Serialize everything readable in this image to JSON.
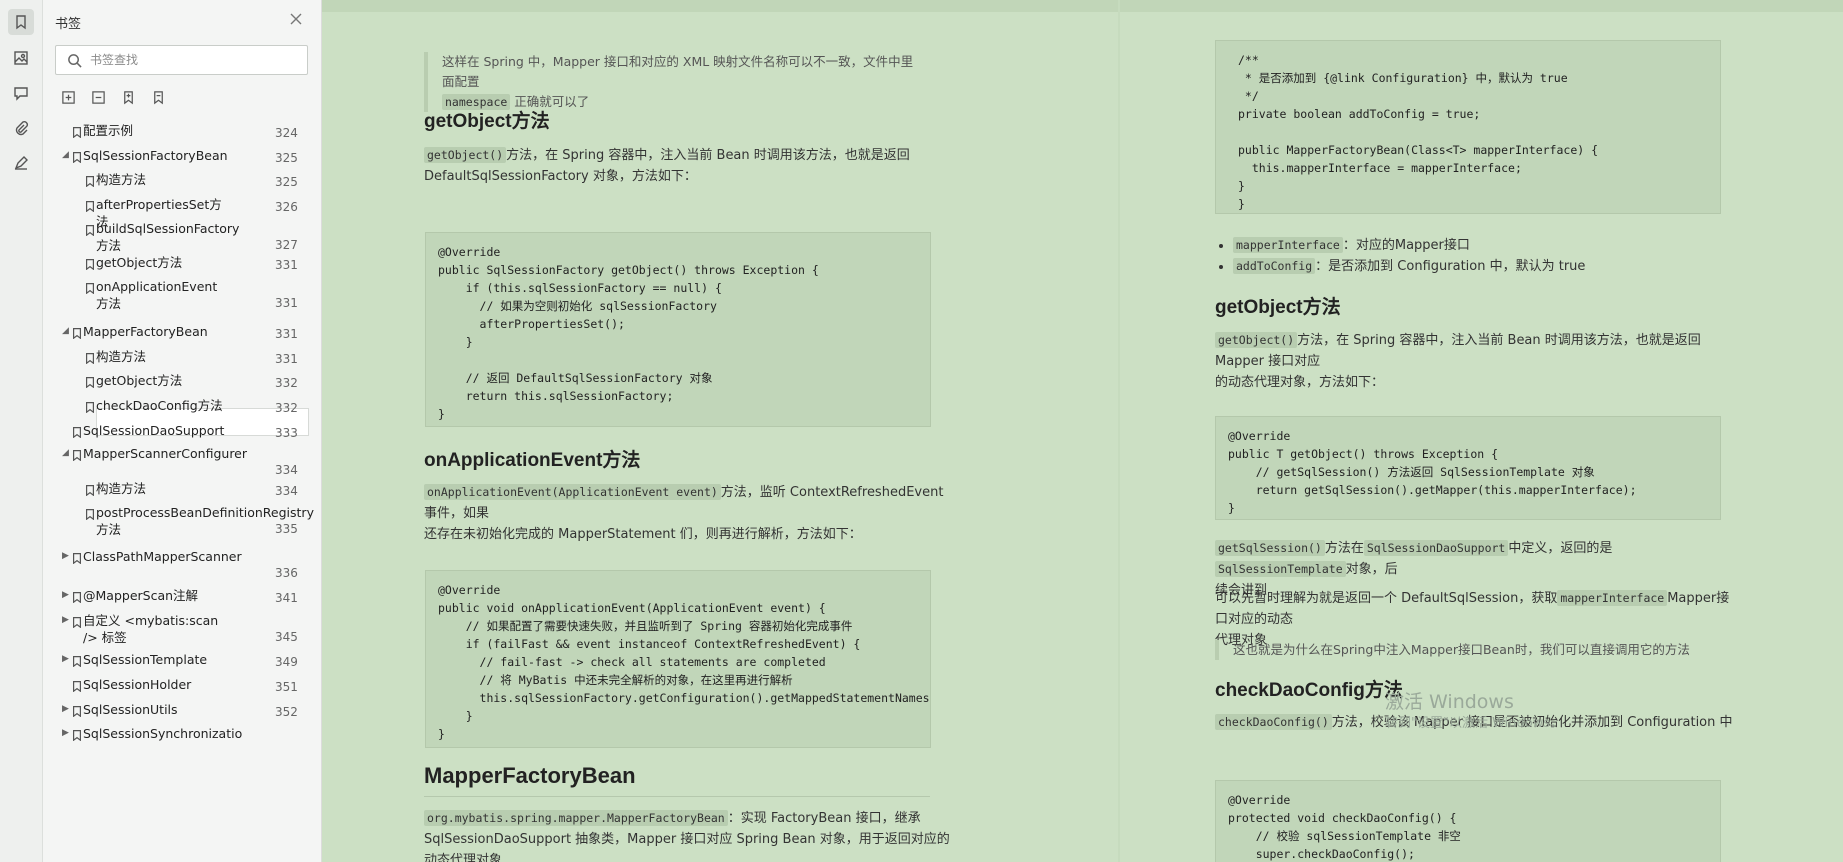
{
  "sidebar": {
    "title": "书签",
    "search_placeholder": "书签查找",
    "items": [
      {
        "label": "配置示例",
        "page": "324",
        "level": 1,
        "toggle": "none"
      },
      {
        "label": "SqlSessionFactoryBean",
        "page": "325",
        "level": 0,
        "toggle": "expanded"
      },
      {
        "label": "构造方法",
        "page": "325",
        "level": 2,
        "toggle": "none"
      },
      {
        "label": "afterPropertiesSet方法",
        "page": "326",
        "level": 2,
        "toggle": "none"
      },
      {
        "label": "buildSqlSessionFactory方法",
        "page": "327",
        "level": 2,
        "toggle": "none"
      },
      {
        "label": "getObject方法",
        "page": "331",
        "level": 2,
        "toggle": "none"
      },
      {
        "label": "onApplicationEvent方法",
        "page": "331",
        "level": 2,
        "toggle": "none"
      },
      {
        "label": "MapperFactoryBean",
        "page": "331",
        "level": 0,
        "toggle": "expanded"
      },
      {
        "label": "构造方法",
        "page": "331",
        "level": 2,
        "toggle": "none"
      },
      {
        "label": "getObject方法",
        "page": "332",
        "level": 2,
        "toggle": "none"
      },
      {
        "label": "checkDaoConfig方法",
        "page": "332",
        "level": 2,
        "toggle": "none"
      },
      {
        "label": "SqlSessionDaoSupport",
        "page": "333",
        "level": 1,
        "toggle": "none"
      },
      {
        "label": "MapperScannerConfigurer",
        "page": "334",
        "level": 0,
        "toggle": "expanded"
      },
      {
        "label": "构造方法",
        "page": "334",
        "level": 2,
        "toggle": "none"
      },
      {
        "label": "postProcessBeanDefinitionRegistry方法",
        "page": "335",
        "level": 2,
        "toggle": "none"
      },
      {
        "label": "ClassPathMapperScanner",
        "page": "336",
        "level": 0,
        "toggle": "collapsed"
      },
      {
        "label": "@MapperScan注解",
        "page": "341",
        "level": 0,
        "toggle": "collapsed"
      },
      {
        "label": "自定义 <mybatis:scan /> 标签",
        "page": "345",
        "level": 0,
        "toggle": "collapsed"
      },
      {
        "label": "SqlSessionTemplate",
        "page": "349",
        "level": 0,
        "toggle": "collapsed"
      },
      {
        "label": "SqlSessionHolder",
        "page": "351",
        "level": 1,
        "toggle": "none"
      },
      {
        "label": "SqlSessionUtils",
        "page": "352",
        "level": 0,
        "toggle": "collapsed"
      },
      {
        "label": "SqlSessionSynchronizatio",
        "page": "",
        "level": 0,
        "toggle": "collapsed"
      }
    ]
  },
  "left": {
    "quote_text_1": "这样在 Spring 中，Mapper 接口和对应的 XML 映射文件名称可以不一致，文件中里面配置",
    "quote_code": "namespace",
    "quote_text_2": "正确就可以了",
    "h_getobject": "getObject方法",
    "p_getobject_code": "getObject()",
    "p_getobject_1": "方法，在 Spring 容器中，注入当前 Bean 时调用该方法，也就是返回",
    "p_getobject_2": "DefaultSqlSessionFactory 对象，方法如下：",
    "code_getobject": "@Override\npublic SqlSessionFactory getObject() throws Exception {\n    if (this.sqlSessionFactory == null) {\n      // 如果为空则初始化 sqlSessionFactory\n      afterPropertiesSet();\n    }\n\n    // 返回 DefaultSqlSessionFactory 对象\n    return this.sqlSessionFactory;\n}",
    "h_onapp": "onApplicationEvent方法",
    "p_onapp_code": "onApplicationEvent(ApplicationEvent event)",
    "p_onapp_1": "方法，监听 ContextRefreshedEvent 事件，如果",
    "p_onapp_2": "还存在未初始化完成的 MapperStatement 们，则再进行解析，方法如下：",
    "code_onapp": "@Override\npublic void onApplicationEvent(ApplicationEvent event) {\n    // 如果配置了需要快速失败，并且监听到了 Spring 容器初始化完成事件\n    if (failFast && event instanceof ContextRefreshedEvent) {\n      // fail-fast -> check all statements are completed\n      // 将 MyBatis 中还未完全解析的对象，在这里再进行解析\n      this.sqlSessionFactory.getConfiguration().getMappedStatementNames();\n    }\n}",
    "h_mfb": "MapperFactoryBean",
    "p_mfb_code": "org.mybatis.spring.mapper.MapperFactoryBean",
    "p_mfb_1": "：实现 FactoryBean 接口，继承",
    "p_mfb_2": "SqlSessionDaoSupport 抽象类，Mapper 接口对应 Spring Bean 对象，用于返回对应的动态代理对象"
  },
  "right": {
    "code_top": "/**\n * 是否添加到 {@link Configuration} 中，默认为 true\n */\nprivate boolean addToConfig = true;\n\npublic MapperFactoryBean(Class<T> mapperInterface) {\n  this.mapperInterface = mapperInterface;\n}\n}",
    "b1_code": "mapperInterface",
    "b1_text": "：对应的Mapper接口",
    "b2_code": "addToConfig",
    "b2_text": "：是否添加到 Configuration 中，默认为 true",
    "h_getobject": "getObject方法",
    "p_getobject_code": "getObject()",
    "p_getobject_1": "方法，在 Spring 容器中，注入当前 Bean 时调用该方法，也就是返回 Mapper 接口对应",
    "p_getobject_2": "的动态代理对象，方法如下：",
    "code_getobject": "@Override\npublic T getObject() throws Exception {\n    // getSqlSession() 方法返回 SqlSessionTemplate 对象\n    return getSqlSession().getMapper(this.mapperInterface);\n}",
    "p_gs_code1": "getSqlSession()",
    "p_gs_1": "方法在",
    "p_gs_code2": "SqlSessionDaoSupport",
    "p_gs_2": "中定义，返回的是",
    "p_gs_code3": "SqlSessionTemplate",
    "p_gs_3": "对象，后",
    "p_gs_4": "续会讲到",
    "p_think_1": "可以先暂时理解为就是返回一个 DefaultSqlSession，获取",
    "p_think_code": "mapperInterface",
    "p_think_2": "Mapper接口对应的动态",
    "p_think_3": "代理对象",
    "quote": "这也就是为什么在Spring中注入Mapper接口Bean时，我们可以直接调用它的方法",
    "h_check": "checkDaoConfig方法",
    "p_check_code": "checkDaoConfig()",
    "p_check_1": "方法，校验该 Mapper 接口是否被初始化并添加到 Configuration 中",
    "code_check": "@Override\nprotected void checkDaoConfig() {\n    // 校验 sqlSessionTemplate 非空\n    super.checkDaoConfig();"
  },
  "watermark": {
    "line1": "激活 Windows",
    "line2": "转到\"设置\"以激活 Windows。"
  }
}
